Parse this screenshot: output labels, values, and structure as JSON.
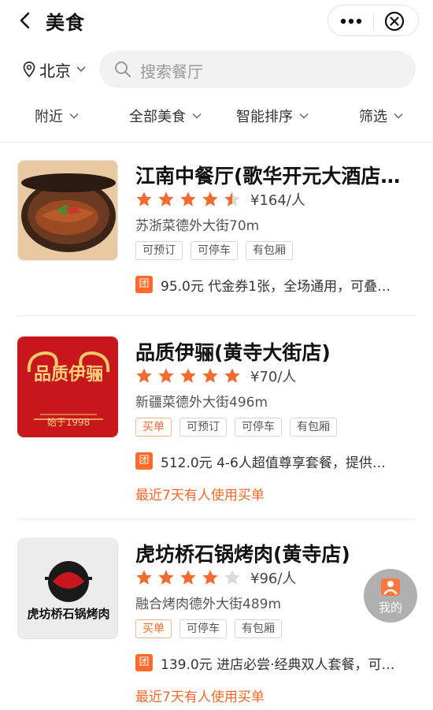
{
  "header": {
    "title": "美食"
  },
  "search": {
    "city": "北京",
    "placeholder": "搜索餐厅"
  },
  "filters": [
    "附近",
    "全部美食",
    "智能排序",
    "筛选"
  ],
  "restaurants": [
    {
      "name": "江南中餐厅(歌华开元大酒店…",
      "rating": 4.5,
      "price": "¥164/人",
      "address": "苏浙菜德外大街70m",
      "tags": [
        "可预订",
        "可停车",
        "有包厢"
      ],
      "deal_badge": "团",
      "deal": "95.0元 代金券1张，全场通用，可叠…",
      "recent": ""
    },
    {
      "name": "品质伊骊(黄寺大街店)",
      "rating": 5,
      "price": "¥70/人",
      "address": "新疆菜德外大街496m",
      "tags": [
        "买单",
        "可预订",
        "可停车",
        "有包厢"
      ],
      "logo_text": "品质伊骊",
      "logo_sub": "始于1998",
      "deal_badge": "团",
      "deal": "512.0元 4-6人超值尊享套餐，提供…",
      "recent": "最近7天有人使用买单"
    },
    {
      "name": "虎坊桥石锅烤肉(黄寺店)",
      "rating": 4,
      "price": "¥96/人",
      "address": "融合烤肉德外大街489m",
      "tags": [
        "买单",
        "可停车",
        "有包厢"
      ],
      "logo_text": "虎坊桥石锅烤肉",
      "deal_badge": "团",
      "deal": "139.0元 进店必尝·经典双人套餐，可…",
      "recent": "最近7天有人使用买单"
    }
  ],
  "fab": {
    "label": "我的"
  },
  "colors": {
    "accent": "#ff6a2a",
    "star": "#f36c2f",
    "star_empty": "#d9d9d9",
    "logo_red": "#c8161d"
  }
}
